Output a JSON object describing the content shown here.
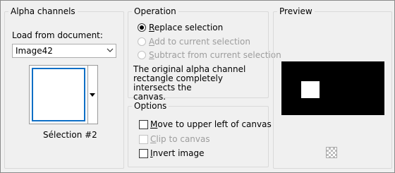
{
  "alpha_channels": {
    "title": "Alpha channels",
    "load_label": "Load from document:",
    "document_value": "Image42",
    "selection_name": "Sélection #2"
  },
  "operation": {
    "title": "Operation",
    "options": [
      {
        "label": "Replace selection",
        "checked": true,
        "enabled": true
      },
      {
        "label": "Add to current selection",
        "checked": false,
        "enabled": false
      },
      {
        "label": "Subtract from current selection",
        "checked": false,
        "enabled": false
      }
    ],
    "description_line1": "The original alpha channel",
    "description_line2": "rectangle completely intersects the",
    "description_line3": "canvas."
  },
  "options": {
    "title": "Options",
    "items": [
      {
        "label": "Move to upper left of canvas",
        "checked": false,
        "enabled": true
      },
      {
        "label": "Clip to canvas",
        "checked": false,
        "enabled": false
      },
      {
        "label": "Invert image",
        "checked": false,
        "enabled": true
      }
    ]
  },
  "preview": {
    "title": "Preview"
  },
  "colors": {
    "accent": "#0d6fc6",
    "panel": "#f0f0f0",
    "preview_bg": "#000000",
    "disabled_text": "#9d9d9d"
  }
}
